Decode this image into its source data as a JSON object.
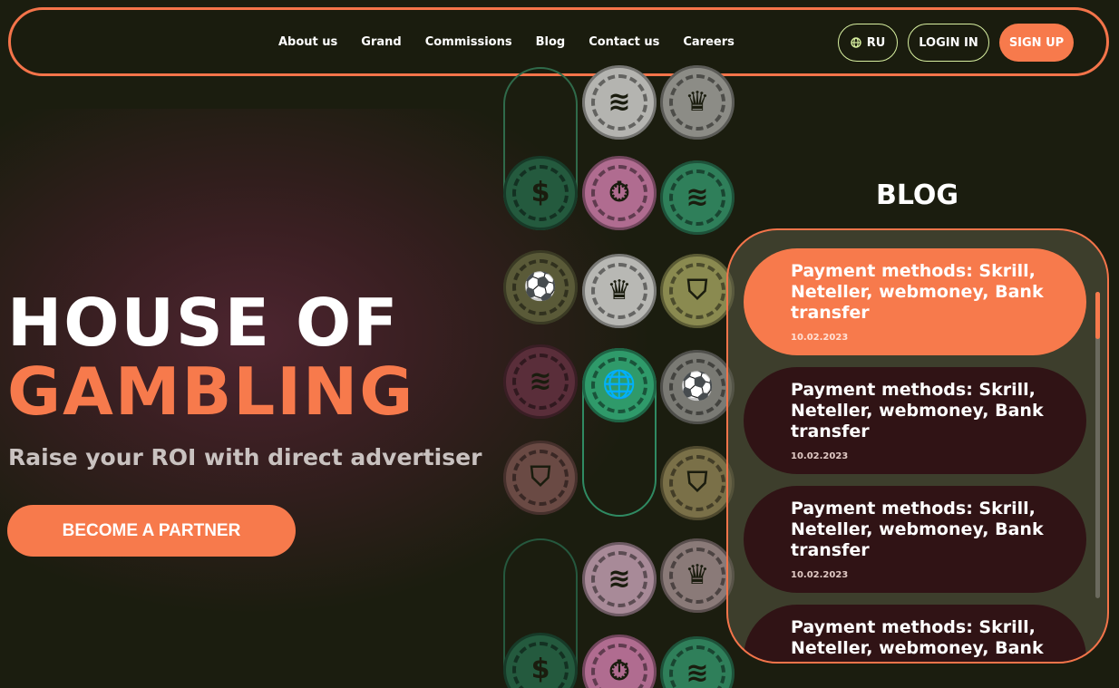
{
  "nav": {
    "links": [
      "About us",
      "Grand",
      "Commissions",
      "Blog",
      "Contact us",
      "Careers"
    ],
    "lang_label": "RU",
    "lang_icon": "globe-icon",
    "login_label": "LOGIN IN",
    "signup_label": "SIGN UP"
  },
  "hero": {
    "title_line1": "HOUSE OF",
    "title_line2": "GAMBLING",
    "subtitle": "Raise your ROI with direct advertiser",
    "cta_label": "BECOME A PARTNER"
  },
  "decor": {
    "chip_icons": [
      "dollar-chip-icon",
      "timer-chip-icon",
      "crown-chip-icon",
      "football-chip-icon",
      "shield-chip-icon",
      "globe-chip-icon",
      "logo-chip-icon"
    ],
    "colors": {
      "green": "#2f7f5a",
      "pink": "#b06c90",
      "grey": "#b4b4b0",
      "olive": "#8a8a50",
      "mauve": "#6a3a48",
      "brown": "#7a5a50"
    }
  },
  "blog": {
    "heading": "BLOG",
    "posts": [
      {
        "title": "Payment methods: Skrill, Neteller, webmoney, Bank transfer",
        "date": "10.02.2023"
      },
      {
        "title": "Payment methods: Skrill, Neteller, webmoney, Bank transfer",
        "date": "10.02.2023"
      },
      {
        "title": "Payment methods: Skrill, Neteller, webmoney, Bank transfer",
        "date": "10.02.2023"
      },
      {
        "title": "Payment methods: Skrill, Neteller, webmoney, Bank transfer",
        "date": ""
      }
    ]
  },
  "colors": {
    "accent": "#f77a4c",
    "background": "#1b1d0f",
    "card": "#301315",
    "outline": "#d8f0a0"
  }
}
